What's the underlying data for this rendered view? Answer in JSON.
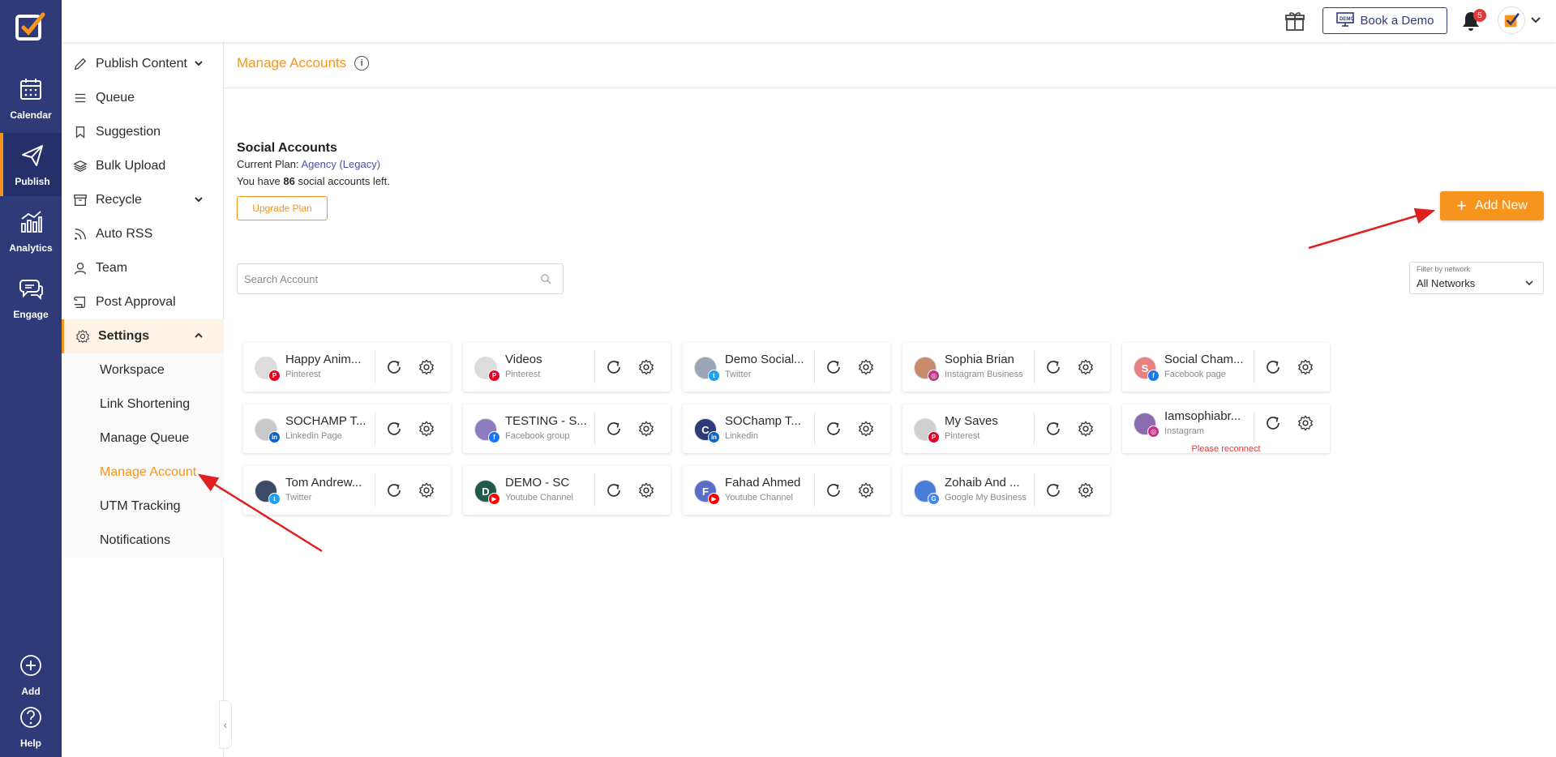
{
  "rail": {
    "items": [
      {
        "label": "Calendar",
        "icon": "calendar-icon"
      },
      {
        "label": "Publish",
        "icon": "paper-plane-icon"
      },
      {
        "label": "Analytics",
        "icon": "bar-chart-icon"
      },
      {
        "label": "Engage",
        "icon": "chat-bubbles-icon"
      },
      {
        "label": "Add",
        "icon": "plus-circle-icon"
      },
      {
        "label": "Help",
        "icon": "question-circle-icon"
      }
    ]
  },
  "topbar": {
    "demo_label": "Book a Demo",
    "notification_count": "5"
  },
  "subnav": {
    "items": [
      {
        "label": "Publish Content"
      },
      {
        "label": "Queue"
      },
      {
        "label": "Suggestion"
      },
      {
        "label": "Bulk Upload"
      },
      {
        "label": "Recycle"
      },
      {
        "label": "Auto RSS"
      },
      {
        "label": "Team"
      },
      {
        "label": "Post Approval"
      },
      {
        "label": "Settings"
      }
    ],
    "settings_children": [
      {
        "label": "Workspace"
      },
      {
        "label": "Link Shortening"
      },
      {
        "label": "Manage Queue"
      },
      {
        "label": "Manage Account"
      },
      {
        "label": "UTM Tracking"
      },
      {
        "label": "Notifications"
      }
    ]
  },
  "main": {
    "title": "Manage Accounts",
    "section_title": "Social Accounts",
    "plan_prefix": "Current Plan: ",
    "plan_name": "Agency (Legacy)",
    "accounts_left_prefix": "You have ",
    "accounts_left_count": "86",
    "accounts_left_suffix": " social accounts left.",
    "upgrade_label": "Upgrade Plan",
    "add_new_label": "Add New",
    "search_placeholder": "Search Account",
    "filter_label": "Filter by network",
    "filter_value": "All Networks",
    "reconnect_text": "Please reconnect"
  },
  "accounts": [
    {
      "name": "Happy Anim...",
      "type": "Pinterest",
      "network": "pinterest"
    },
    {
      "name": "Videos",
      "type": "Pinterest",
      "network": "pinterest"
    },
    {
      "name": "Demo Social...",
      "type": "Twitter",
      "network": "twitter"
    },
    {
      "name": "Sophia Brian",
      "type": "Instagram Business",
      "network": "instagram"
    },
    {
      "name": "Social Cham...",
      "type": "Facebook page",
      "network": "facebook"
    },
    {
      "name": "SOCHAMP T...",
      "type": "Linkedin Page",
      "network": "linkedin"
    },
    {
      "name": "TESTING - S...",
      "type": "Facebook group",
      "network": "facebook"
    },
    {
      "name": "SOChamp T...",
      "type": "Linkedin",
      "network": "linkedin"
    },
    {
      "name": "My Saves",
      "type": "Pinterest",
      "network": "pinterest"
    },
    {
      "name": "Iamsophiabr...",
      "type": "Instagram",
      "network": "instagram"
    },
    {
      "name": "Tom Andrew...",
      "type": "Twitter",
      "network": "twitter"
    },
    {
      "name": "DEMO - SC",
      "type": "Youtube Channel",
      "network": "youtube"
    },
    {
      "name": "Fahad Ahmed",
      "type": "Youtube Channel",
      "network": "youtube"
    },
    {
      "name": "Zohaib And ...",
      "type": "Google My Business",
      "network": "google"
    }
  ],
  "colors": {
    "rail": "#2f3a78",
    "accent": "#f7941d",
    "pinterest": "#e60023",
    "twitter": "#1da1f2",
    "instagram": "#c13584",
    "facebook": "#1877f2",
    "linkedin": "#0a66c2",
    "youtube": "#ff0000",
    "google": "#4285f4"
  }
}
